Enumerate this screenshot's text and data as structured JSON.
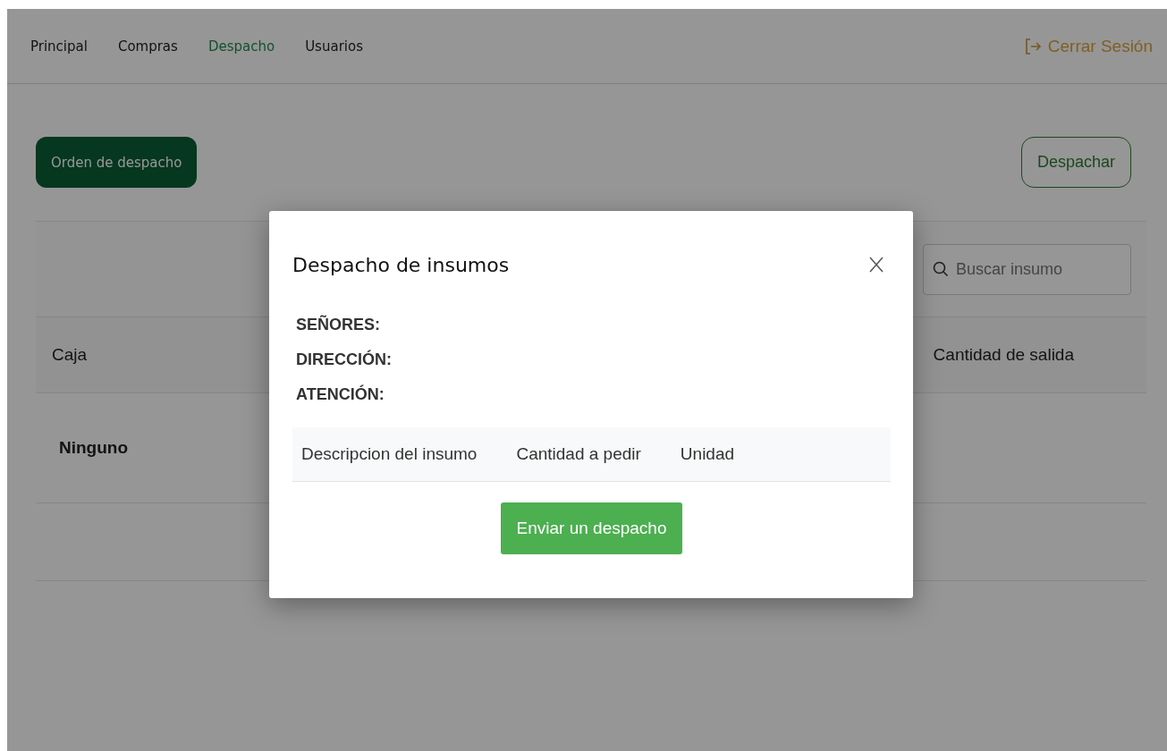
{
  "nav": {
    "items": [
      {
        "label": "Principal",
        "selected": false
      },
      {
        "label": "Compras",
        "selected": false
      },
      {
        "label": "Despacho",
        "selected": true
      },
      {
        "label": "Usuarios",
        "selected": false
      }
    ],
    "logout": {
      "label": "Cerrar Sesión"
    }
  },
  "toolbar": {
    "primary_button": "Orden de despacho",
    "secondary_button": "Despachar"
  },
  "table": {
    "search": {
      "placeholder": "Buscar insumo"
    },
    "columns": [
      "Caja",
      "Cantidad de salida"
    ],
    "rows": [
      {
        "cells": [
          "Ninguno"
        ]
      }
    ]
  },
  "modal": {
    "title": "Despacho de insumos",
    "fields": [
      "SEÑORES:",
      "DIRECCIÓN:",
      "ATENCIÓN:"
    ],
    "columns": [
      "Descripcion del insumo",
      "Cantidad a pedir",
      "Unidad"
    ],
    "submit": "Enviar un despacho"
  }
}
